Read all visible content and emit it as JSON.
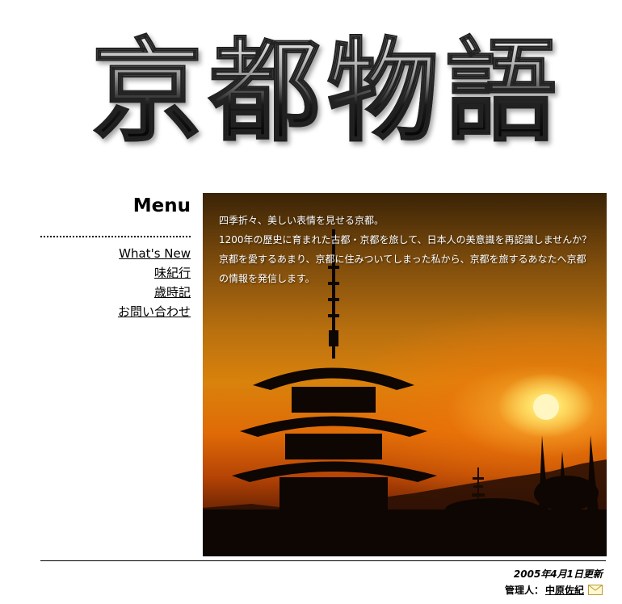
{
  "banner": {
    "title": "京都物語"
  },
  "menu": {
    "heading": "Menu",
    "items": [
      {
        "label": "What's New"
      },
      {
        "label": "味紀行"
      },
      {
        "label": "歳時記"
      },
      {
        "label": "お問い合わせ"
      }
    ]
  },
  "hero": {
    "intro_lines": [
      "四季折々、美しい表情を見せる京都。",
      "1200年の歴史に育まれた古都・京都を旅して、日本人の美意識を再認識しませんか？",
      "京都を愛するあまり、京都に住みついてしまった私から、京都を旅するあなたへ京都の情報を発信します。"
    ]
  },
  "footer": {
    "updated": "2005年4月1日更新",
    "admin_label": "管理人：",
    "admin_name": "中原佐紀",
    "mail_icon": "mail-icon"
  },
  "colors": {
    "sunset_orange": "#e06b07",
    "sun_yellow": "#ffe36a",
    "silhouette": "#0d0603"
  }
}
